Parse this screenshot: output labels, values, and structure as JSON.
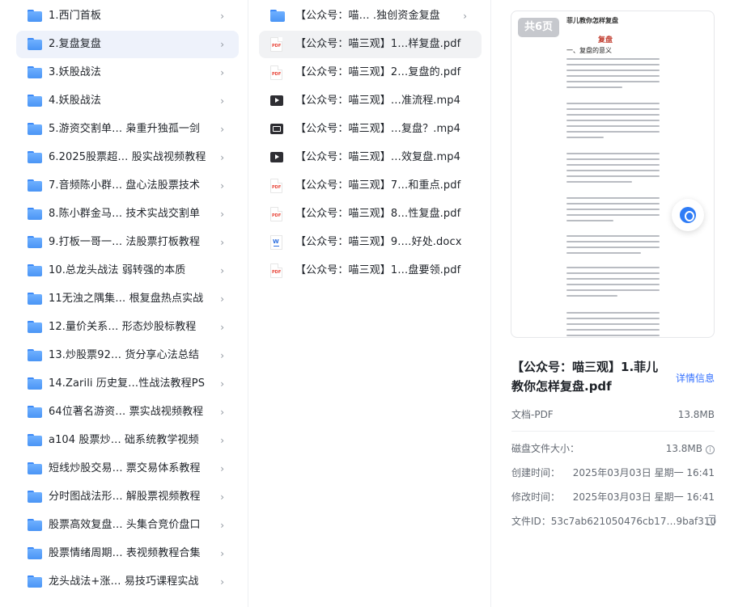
{
  "folders": [
    {
      "label": "1.西门首板"
    },
    {
      "label": "2.复盘复盘"
    },
    {
      "label": "3.妖股战法"
    },
    {
      "label": "4.妖股战法"
    },
    {
      "label": "5.游资交割单… 枭重升独孤一剑"
    },
    {
      "label": "6.2025股票超… 股实战视频教程"
    },
    {
      "label": "7.音频陈小群… 盘心法股票技术"
    },
    {
      "label": "8.陈小群金马… 技术实战交割单"
    },
    {
      "label": "9.打板一哥一… 法股票打板教程"
    },
    {
      "label": "10.总龙头战法 弱转强的本质"
    },
    {
      "label": "11无浊之隅集… 根复盘热点实战"
    },
    {
      "label": "12.量价关系… 形态炒股标教程"
    },
    {
      "label": "13.炒股票92… 货分享心法总结"
    },
    {
      "label": "14.Zarili 历史复…性战法教程PS"
    },
    {
      "label": "64位著名游资… 票实战视频教程"
    },
    {
      "label": "a104 股票炒… 础系统教学视频"
    },
    {
      "label": "短线炒股交易… 票交易体系教程"
    },
    {
      "label": "分时图战法形… 解股票视频教程"
    },
    {
      "label": "股票高效复盘… 头集合竞价盘口"
    },
    {
      "label": "股票情绪周期… 表视频教程合集"
    },
    {
      "label": "龙头战法+涨… 易技巧课程实战"
    }
  ],
  "files": [
    {
      "label": "【公众号：喵…  .独创资金复盘",
      "icon": "folder-icon"
    },
    {
      "label": "【公众号：喵三观】1…样复盘.pdf",
      "icon": "pdf-icon"
    },
    {
      "label": "【公众号：喵三观】2…复盘的.pdf",
      "icon": "pdf-icon"
    },
    {
      "label": "【公众号：喵三观】…准流程.mp4",
      "icon": "video-icon"
    },
    {
      "label": "【公众号：喵三观】…复盘？.mp4",
      "icon": "video-icon"
    },
    {
      "label": "【公众号：喵三观】…效复盘.mp4",
      "icon": "video-icon"
    },
    {
      "label": "【公众号：喵三观】7…和重点.pdf",
      "icon": "pdf-icon"
    },
    {
      "label": "【公众号：喵三观】8…性复盘.pdf",
      "icon": "pdf-icon"
    },
    {
      "label": "【公众号：喵三观】9.…好处.docx",
      "icon": "docx-icon"
    },
    {
      "label": "【公众号：喵三观】1…盘要领.pdf",
      "icon": "pdf-icon"
    }
  ],
  "preview": {
    "pages_badge": "共6页",
    "doc_heading": "菲儿教你怎样复盘",
    "doc_title": "复盘",
    "doc_section": "一、复盘的意义",
    "pdf_badge": "PDF",
    "docx_badge": "W"
  },
  "details": {
    "file_title": "【公众号：喵三观】1.菲儿教你怎样复盘.pdf",
    "details_link": "详情信息",
    "type_label": "文档-PDF",
    "type_size": "13.8MB",
    "disk_size_label": "磁盘文件大小：",
    "disk_size_value": "13.8MB",
    "created_label": "创建时间：",
    "created_value": "2025年03月03日 星期一 16:41",
    "modified_label": "修改时间：",
    "modified_value": "2025年03月03日 星期一 16:41",
    "fileid_label": "文件ID：",
    "fileid_value": "53c7ab621050476cb17…9baf310"
  },
  "chevron": "›",
  "info_glyph": "i"
}
